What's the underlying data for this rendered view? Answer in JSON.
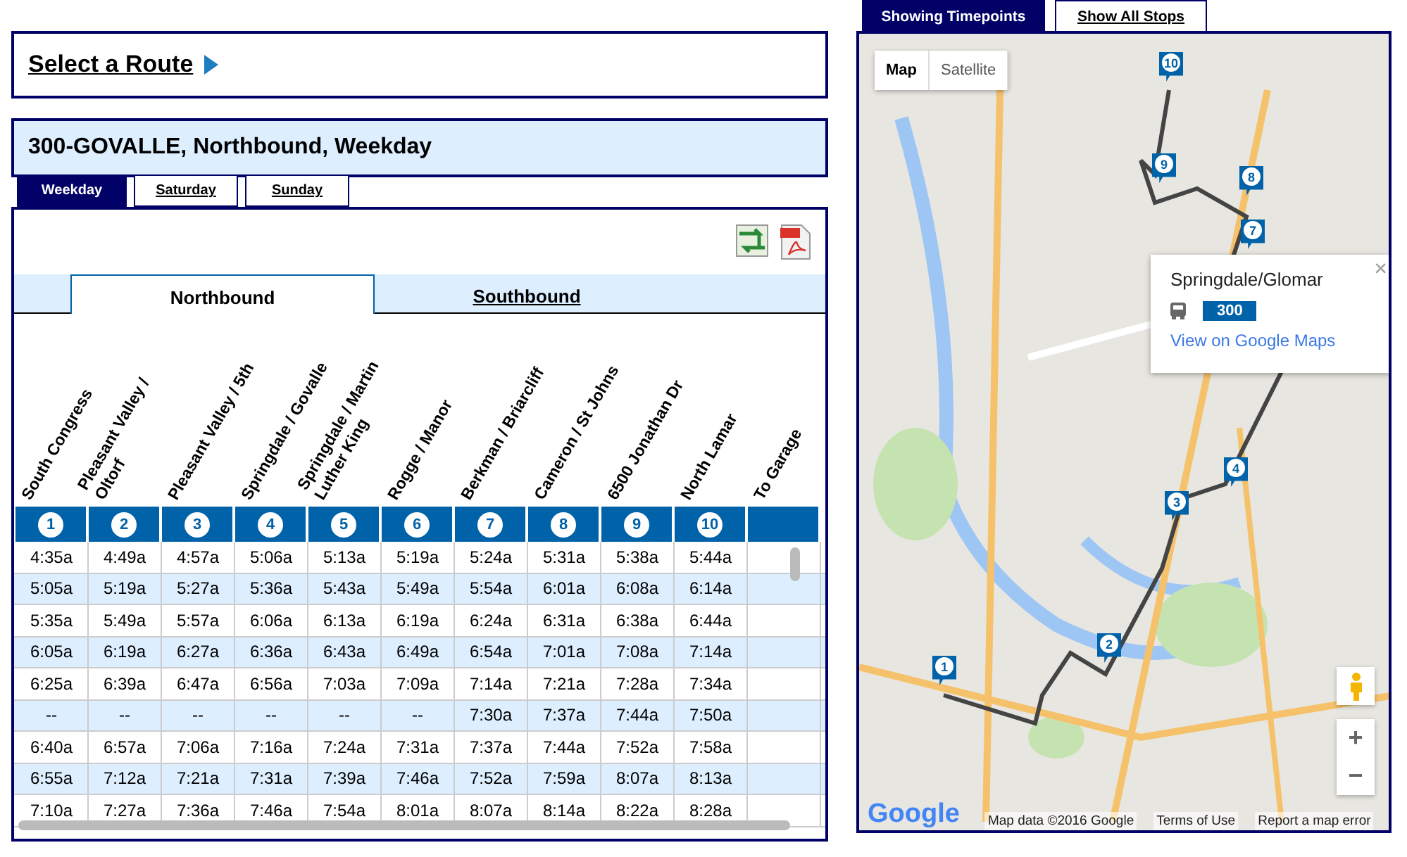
{
  "route_selector": {
    "label": "Select a Route"
  },
  "route_header": {
    "title": "300-GOVALLE, Northbound, Weekday"
  },
  "day_tabs": [
    {
      "label": "Weekday",
      "selected": true
    },
    {
      "label": "Saturday",
      "selected": false
    },
    {
      "label": "Sunday",
      "selected": false
    }
  ],
  "direction_tabs": [
    {
      "label": "Northbound",
      "selected": true
    },
    {
      "label": "Southbound",
      "selected": false
    }
  ],
  "table": {
    "columns": [
      {
        "name": "South Congress",
        "number": "1"
      },
      {
        "name": "Pleasant Valley / Oltorf",
        "number": "2"
      },
      {
        "name": "Pleasant Valley / 5th",
        "number": "3"
      },
      {
        "name": "Springdale / Govalle",
        "number": "4"
      },
      {
        "name": "Springdale / Martin Luther King",
        "number": "5"
      },
      {
        "name": "Rogge / Manor",
        "number": "6"
      },
      {
        "name": "Berkman / Briarcliff",
        "number": "7"
      },
      {
        "name": "Cameron / St Johns",
        "number": "8"
      },
      {
        "name": "6500 Jonathan Dr",
        "number": "9"
      },
      {
        "name": "North Lamar",
        "number": "10"
      },
      {
        "name": "To Garage"
      }
    ],
    "rows": [
      [
        "4:35a",
        "4:49a",
        "4:57a",
        "5:06a",
        "5:13a",
        "5:19a",
        "5:24a",
        "5:31a",
        "5:38a",
        "5:44a"
      ],
      [
        "5:05a",
        "5:19a",
        "5:27a",
        "5:36a",
        "5:43a",
        "5:49a",
        "5:54a",
        "6:01a",
        "6:08a",
        "6:14a"
      ],
      [
        "5:35a",
        "5:49a",
        "5:57a",
        "6:06a",
        "6:13a",
        "6:19a",
        "6:24a",
        "6:31a",
        "6:38a",
        "6:44a"
      ],
      [
        "6:05a",
        "6:19a",
        "6:27a",
        "6:36a",
        "6:43a",
        "6:49a",
        "6:54a",
        "7:01a",
        "7:08a",
        "7:14a"
      ],
      [
        "6:25a",
        "6:39a",
        "6:47a",
        "6:56a",
        "7:03a",
        "7:09a",
        "7:14a",
        "7:21a",
        "7:28a",
        "7:34a"
      ],
      [
        "--",
        "--",
        "--",
        "--",
        "--",
        "--",
        "7:30a",
        "7:37a",
        "7:44a",
        "7:50a"
      ],
      [
        "6:40a",
        "6:57a",
        "7:06a",
        "7:16a",
        "7:24a",
        "7:31a",
        "7:37a",
        "7:44a",
        "7:52a",
        "7:58a"
      ],
      [
        "6:55a",
        "7:12a",
        "7:21a",
        "7:31a",
        "7:39a",
        "7:46a",
        "7:52a",
        "7:59a",
        "8:07a",
        "8:13a"
      ],
      [
        "7:10a",
        "7:27a",
        "7:36a",
        "7:46a",
        "7:54a",
        "8:01a",
        "8:07a",
        "8:14a",
        "8:22a",
        "8:28a"
      ]
    ]
  },
  "map_tabs": [
    {
      "label": "Showing Timepoints",
      "selected": true
    },
    {
      "label": "Show All Stops",
      "selected": false
    }
  ],
  "map": {
    "kind": "picture",
    "type_toggle": [
      {
        "label": "Map",
        "selected": true
      },
      {
        "label": "Satellite",
        "selected": false
      }
    ],
    "markers": [
      "10",
      "9",
      "8",
      "7",
      "4",
      "3",
      "2",
      "1"
    ],
    "popup": {
      "title": "Springdale/Glomar",
      "route": "300",
      "link": "View on Google Maps",
      "close": "×"
    },
    "zoom_in": "+",
    "zoom_out": "−",
    "logo": "Google",
    "attribution": [
      "Map data ©2016 Google",
      "Terms of Use",
      "Report a map error"
    ]
  }
}
